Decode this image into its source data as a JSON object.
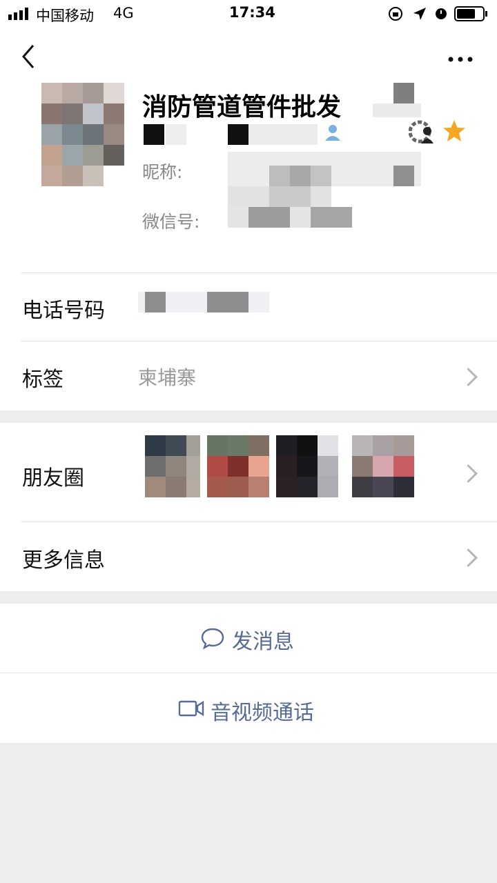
{
  "status_bar": {
    "carrier": "中国移动",
    "network": "4G",
    "time": "17:34"
  },
  "header": {
    "back_icon": "chevron-left-icon",
    "more_icon": "more-dots-icon"
  },
  "profile": {
    "name": "消防管道管件批发",
    "nickname_label": "昵称:",
    "wechat_id_label": "微信号:",
    "star_color": "#f5a623"
  },
  "rows": {
    "phone_label": "电话号码",
    "tags_label": "标签",
    "tags_value": "柬埔寨",
    "moments_label": "朋友圈",
    "more_info_label": "更多信息"
  },
  "actions": {
    "send_message": "发消息",
    "av_call": "音视频通话",
    "accent_color": "#576b95"
  }
}
